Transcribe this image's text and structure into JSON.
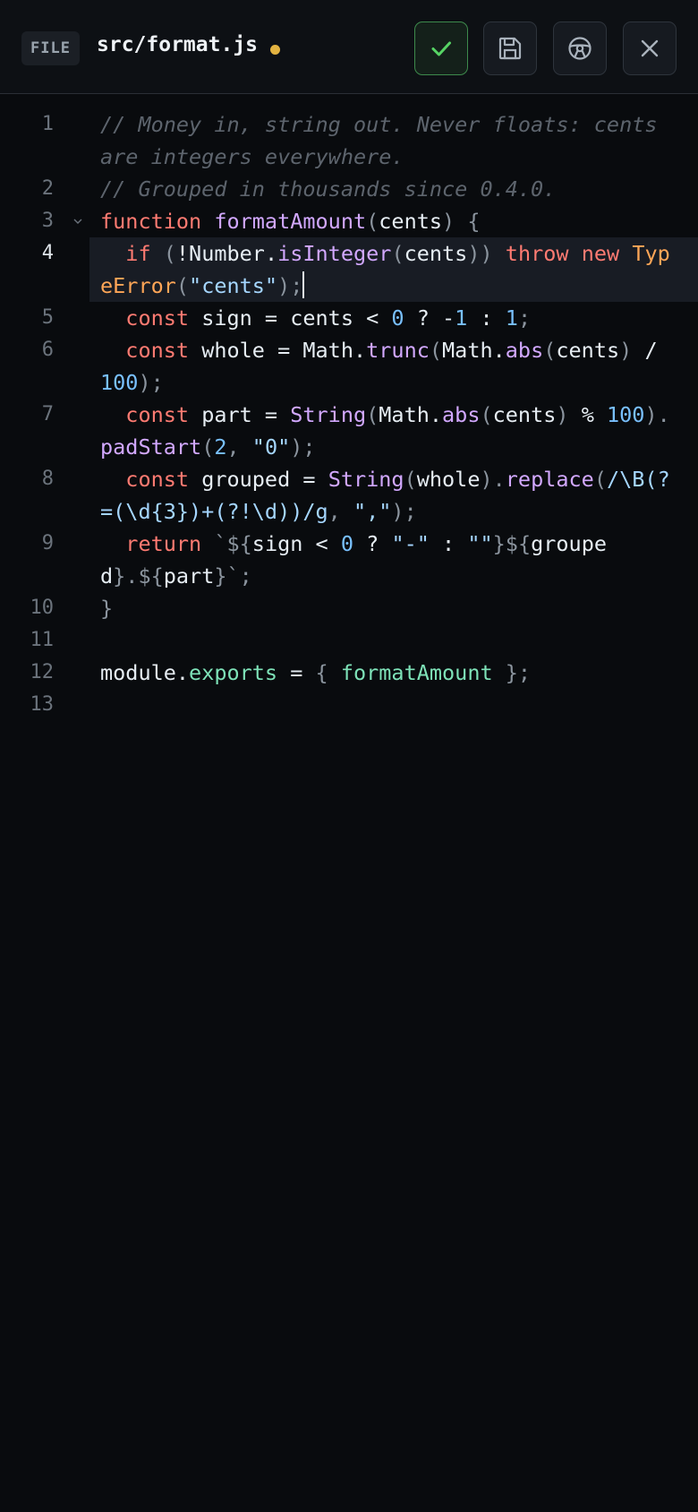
{
  "header": {
    "file_badge": "FILE",
    "file_name": "src/format.js",
    "dirty_color": "#e3b341",
    "buttons": [
      {
        "name": "apply-button",
        "icon": "check-icon"
      },
      {
        "name": "save-button",
        "icon": "save-icon"
      },
      {
        "name": "steering-button",
        "icon": "steering-wheel-icon"
      },
      {
        "name": "close-button",
        "icon": "close-icon"
      }
    ]
  },
  "editor": {
    "active_line": 4,
    "lines": [
      {
        "n": "1",
        "rows": 2,
        "tokens": [
          [
            "com",
            "// Money in, string out. Never floats: cents are integers everywhere."
          ]
        ]
      },
      {
        "n": "2",
        "rows": 1,
        "tokens": [
          [
            "com",
            "// Grouped in thousands since 0.4.0."
          ]
        ]
      },
      {
        "n": "3",
        "rows": 1,
        "fold": true,
        "tokens": [
          [
            "kw",
            "function"
          ],
          [
            "id",
            " "
          ],
          [
            "fn",
            "formatAmount"
          ],
          [
            "p",
            "("
          ],
          [
            "id",
            "cents"
          ],
          [
            "p",
            ") {"
          ]
        ]
      },
      {
        "n": "4",
        "rows": 2,
        "cursor": true,
        "tokens": [
          [
            "id",
            "  "
          ],
          [
            "kw",
            "if"
          ],
          [
            "id",
            " "
          ],
          [
            "p",
            "("
          ],
          [
            "id",
            "!Number."
          ],
          [
            "fn",
            "isInteger"
          ],
          [
            "p",
            "("
          ],
          [
            "id",
            "cents"
          ],
          [
            "p",
            "))"
          ],
          [
            "id",
            " "
          ],
          [
            "kw",
            "throw"
          ],
          [
            "id",
            " "
          ],
          [
            "kw",
            "new"
          ],
          [
            "id",
            " "
          ],
          [
            "cls",
            "TypeError"
          ],
          [
            "p",
            "("
          ],
          [
            "str",
            "\"cents\""
          ],
          [
            "p",
            ");"
          ]
        ]
      },
      {
        "n": "5",
        "rows": 1,
        "tokens": [
          [
            "id",
            "  "
          ],
          [
            "kw",
            "const"
          ],
          [
            "id",
            " sign = cents < "
          ],
          [
            "num",
            "0"
          ],
          [
            "id",
            " ? -"
          ],
          [
            "num",
            "1"
          ],
          [
            "id",
            " : "
          ],
          [
            "num",
            "1"
          ],
          [
            "p",
            ";"
          ]
        ]
      },
      {
        "n": "6",
        "rows": 2,
        "tokens": [
          [
            "id",
            "  "
          ],
          [
            "kw",
            "const"
          ],
          [
            "id",
            " whole = Math."
          ],
          [
            "fn",
            "trunc"
          ],
          [
            "p",
            "("
          ],
          [
            "id",
            "Math."
          ],
          [
            "fn",
            "abs"
          ],
          [
            "p",
            "("
          ],
          [
            "id",
            "cents"
          ],
          [
            "p",
            ")"
          ],
          [
            "id",
            " / "
          ],
          [
            "num",
            "100"
          ],
          [
            "p",
            ");"
          ]
        ]
      },
      {
        "n": "7",
        "rows": 2,
        "tokens": [
          [
            "id",
            "  "
          ],
          [
            "kw",
            "const"
          ],
          [
            "id",
            " part = "
          ],
          [
            "fn",
            "String"
          ],
          [
            "p",
            "("
          ],
          [
            "id",
            "Math."
          ],
          [
            "fn",
            "abs"
          ],
          [
            "p",
            "("
          ],
          [
            "id",
            "cents"
          ],
          [
            "p",
            ")"
          ],
          [
            "id",
            " % "
          ],
          [
            "num",
            "100"
          ],
          [
            "p",
            ")."
          ],
          [
            "fn",
            "padStart"
          ],
          [
            "p",
            "("
          ],
          [
            "num",
            "2"
          ],
          [
            "p",
            ", "
          ],
          [
            "str",
            "\"0\""
          ],
          [
            "p",
            ");"
          ]
        ]
      },
      {
        "n": "8",
        "rows": 2,
        "tokens": [
          [
            "id",
            "  "
          ],
          [
            "kw",
            "const"
          ],
          [
            "id",
            " grouped = "
          ],
          [
            "fn",
            "String"
          ],
          [
            "p",
            "("
          ],
          [
            "id",
            "whole"
          ],
          [
            "p",
            ")."
          ],
          [
            "fn",
            "replace"
          ],
          [
            "p",
            "("
          ],
          [
            "re",
            "/\\B(?=(\\d{3})+(?!\\d))/g"
          ],
          [
            "p",
            ", "
          ],
          [
            "str",
            "\",\""
          ],
          [
            "p",
            ");"
          ]
        ]
      },
      {
        "n": "9",
        "rows": 2,
        "tokens": [
          [
            "id",
            "  "
          ],
          [
            "kw",
            "return"
          ],
          [
            "id",
            " "
          ],
          [
            "p",
            "`${"
          ],
          [
            "id",
            "sign < "
          ],
          [
            "num",
            "0"
          ],
          [
            "id",
            " ? "
          ],
          [
            "str",
            "\"-\""
          ],
          [
            "id",
            " : "
          ],
          [
            "str",
            "\"\""
          ],
          [
            "p",
            "}${"
          ],
          [
            "id",
            "grouped"
          ],
          [
            "p",
            "}.${"
          ],
          [
            "id",
            "part"
          ],
          [
            "p",
            "}`;"
          ]
        ]
      },
      {
        "n": "10",
        "rows": 1,
        "tokens": [
          [
            "p",
            "}"
          ]
        ]
      },
      {
        "n": "11",
        "rows": 1,
        "tokens": []
      },
      {
        "n": "12",
        "rows": 1,
        "tokens": [
          [
            "id",
            "module."
          ],
          [
            "prop",
            "exports"
          ],
          [
            "id",
            " = "
          ],
          [
            "p",
            "{ "
          ],
          [
            "prop",
            "formatAmount"
          ],
          [
            "p",
            " };"
          ]
        ]
      },
      {
        "n": "13",
        "rows": 1,
        "tokens": []
      }
    ]
  }
}
